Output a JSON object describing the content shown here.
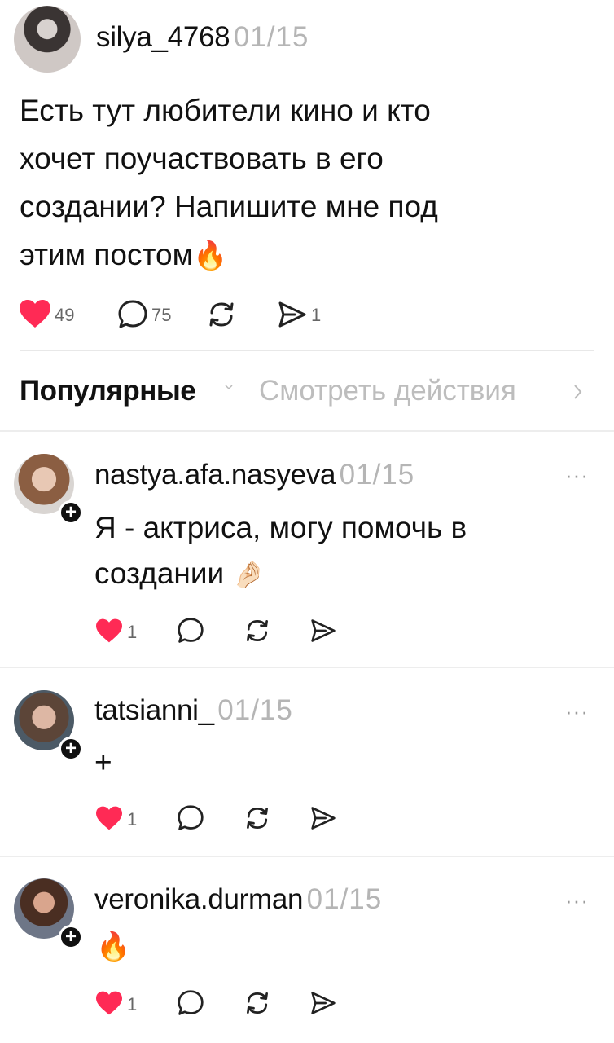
{
  "post": {
    "username": "silya_4768",
    "date": "01/15",
    "text_lines": [
      "Есть тут любители кино и кто",
      "хочет поучаствовать в его",
      "создании? Напишите мне под",
      "этим постом"
    ],
    "emoji": "🔥",
    "likes": "49",
    "comments": "75",
    "shares": "1"
  },
  "tabs": {
    "popular": "Популярные",
    "view_activity": "Смотреть действия"
  },
  "comments": [
    {
      "username": "nastya.afa.nasyeva",
      "date": "01/15",
      "lines": [
        "Я - актриса, могу помочь в",
        "создании"
      ],
      "emoji": "🤌🏻",
      "likes": "1"
    },
    {
      "username": "tatsianni_",
      "date": "01/15",
      "lines": [
        "+"
      ],
      "likes": "1"
    },
    {
      "username": "veronika.durman",
      "date": "01/15",
      "lines": [],
      "emoji": "🔥",
      "likes": "1"
    }
  ],
  "colors": {
    "like_red": "#ff2a55",
    "muted": "#b5b5b5",
    "icon": "#222222"
  }
}
